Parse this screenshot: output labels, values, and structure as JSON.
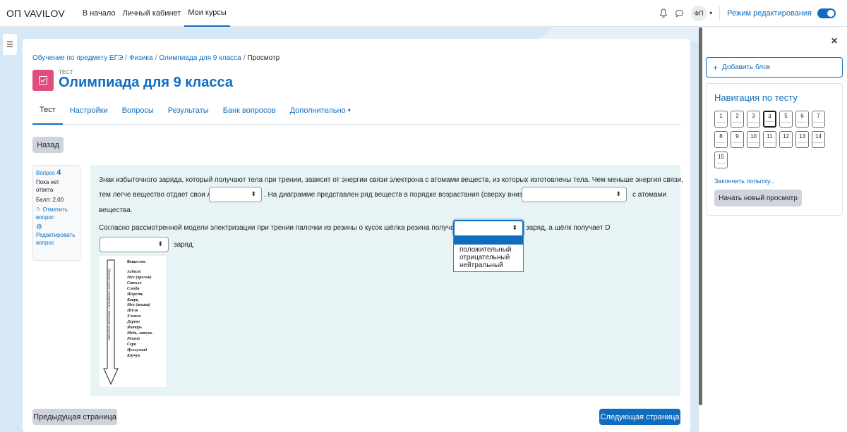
{
  "header": {
    "brand": "ОП VAVILOV",
    "nav": [
      "В начало",
      "Личный кабинет",
      "Мои курсы"
    ],
    "user_initials": "ФП",
    "edit_mode_label": "Режим редактирования"
  },
  "breadcrumb": {
    "items": [
      "Обучение по предмету ЕГЭ",
      "Физика",
      "Олимпиада для 9 класса"
    ],
    "current": "Просмотр"
  },
  "activity": {
    "type": "ТЕСТ",
    "title": "Олимпиада для 9 класса"
  },
  "tabs": [
    "Тест",
    "Настройки",
    "Вопросы",
    "Результаты",
    "Банк вопросов",
    "Дополнительно"
  ],
  "back_button": "Назад",
  "question_info": {
    "label": "Вопрос",
    "number": "4",
    "status": "Пока нет ответа",
    "grade": "Балл: 2,00",
    "flag": "Отметить вопрос",
    "edit": "Редактировать вопрос"
  },
  "question": {
    "line1": "Знак избыточного заряда, который получают тела при трении, зависит от энергии связи электрона с атомами веществ, из которых изготовлены тела. Чем меньше энергия связи,",
    "line2a": "тем легче вещество отдает свои А",
    "line2b": ". На диаграмме представлен ряд веществ в порядке возрастания (сверху вниз) В",
    "line2c": "с атомами",
    "line3": "вещества.",
    "line4a": "Согласно рассмотренной модели электризации при трении палочки из резины о кусок шёлка резина получает С",
    "line4b": "заряд, а шёлк получает D",
    "line5": "заряд.",
    "dropdown_options": [
      "положительный",
      "отрицательный",
      "нейтральный"
    ]
  },
  "diagram": {
    "header": "Вещество",
    "axis_label": "Энергия связи электронов с атомами вещества",
    "items": [
      "Асбест",
      "Мех (кролик)",
      "Стекло",
      "Слюда",
      "Шерсть",
      "Кварц",
      "Мех (кошка)",
      "Шёлк",
      "Хлопок",
      "Дерево",
      "Янтарь",
      "Медь, латунь",
      "Резина",
      "Сера",
      "Целлулоид",
      "Каучук"
    ]
  },
  "footer": {
    "prev": "Предыдущая страница",
    "next": "Следующая страница"
  },
  "sidebar": {
    "add_block": "Добавить блок",
    "nav_title": "Навигация по тесту",
    "questions": [
      "1",
      "2",
      "3",
      "4",
      "5",
      "6",
      "7",
      "8",
      "9",
      "10",
      "11",
      "12",
      "13",
      "14",
      "15"
    ],
    "current_question": "4",
    "finish": "Закончить попытку...",
    "new_preview": "Начать новый просмотр"
  }
}
